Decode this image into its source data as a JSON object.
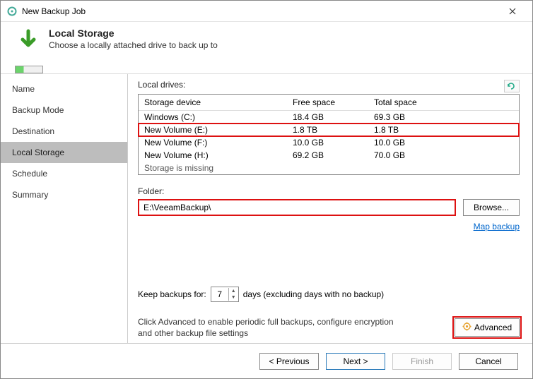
{
  "window": {
    "title": "New Backup Job"
  },
  "header": {
    "title": "Local Storage",
    "subtitle": "Choose a locally attached drive to back up to"
  },
  "sidebar": {
    "items": [
      {
        "label": "Name"
      },
      {
        "label": "Backup Mode"
      },
      {
        "label": "Destination"
      },
      {
        "label": "Local Storage",
        "selected": true
      },
      {
        "label": "Schedule"
      },
      {
        "label": "Summary"
      }
    ]
  },
  "drives": {
    "label": "Local drives:",
    "columns": {
      "name": "Storage device",
      "free": "Free space",
      "total": "Total space"
    },
    "rows": [
      {
        "name": "Windows (C:)",
        "free": "18.4 GB",
        "total": "69.3 GB"
      },
      {
        "name": "New Volume (E:)",
        "free": "1.8 TB",
        "total": "1.8 TB",
        "selected": true
      },
      {
        "name": "New Volume (F:)",
        "free": "10.0 GB",
        "total": "10.0 GB"
      },
      {
        "name": "New Volume (H:)",
        "free": "69.2 GB",
        "total": "70.0 GB"
      },
      {
        "name": "Storage is missing",
        "free": "",
        "total": "",
        "missing": true
      }
    ]
  },
  "folder": {
    "label": "Folder:",
    "value": "E:\\VeeamBackup\\",
    "browse": "Browse..."
  },
  "map_link": "Map backup",
  "keep": {
    "prefix": "Keep backups for:",
    "value": "7",
    "suffix": "days (excluding days with no backup)"
  },
  "advanced": {
    "text": "Click Advanced to enable periodic full backups, configure encryption and other backup file settings",
    "button": "Advanced"
  },
  "footer": {
    "previous": "< Previous",
    "next": "Next >",
    "finish": "Finish",
    "cancel": "Cancel"
  }
}
